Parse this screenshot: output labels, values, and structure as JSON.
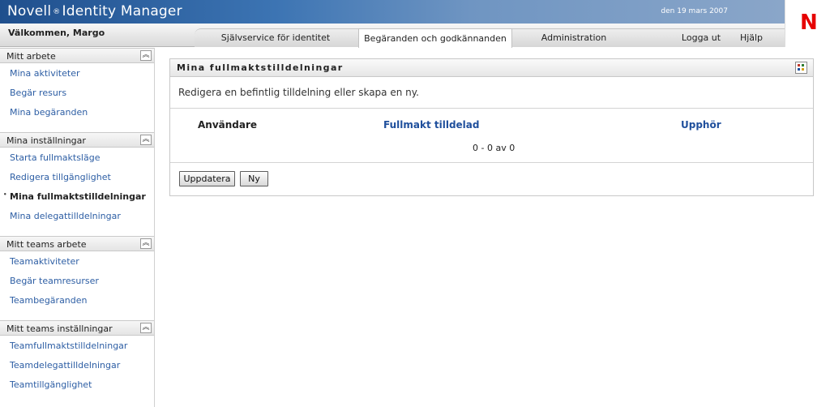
{
  "header": {
    "brand_name": "Novell",
    "brand_reg": "®",
    "brand_product": "Identity Manager",
    "date": "den 19 mars 2007",
    "welcome": "Välkommen, Margo",
    "logo_letter": "N",
    "colors": {
      "brand_blue": "#2d62a4",
      "logo_red": "#e60000",
      "link_blue": "#2d5ea4"
    }
  },
  "tabs": [
    {
      "label": "Självservice för identitet"
    },
    {
      "label": "Begäranden och godkännanden",
      "active": true
    },
    {
      "label": "Administration"
    },
    {
      "label": "Logga ut"
    },
    {
      "label": "Hjälp"
    }
  ],
  "sidebar": {
    "sections": [
      {
        "title": "Mitt arbete",
        "items": [
          "Mina aktiviteter",
          "Begär resurs",
          "Mina begäranden"
        ]
      },
      {
        "title": "Mina inställningar",
        "items": [
          "Starta fullmaktsläge",
          "Redigera tillgänglighet",
          "Mina fullmaktstilldelningar",
          "Mina delegattilldelningar"
        ],
        "current": "Mina fullmaktstilldelningar"
      },
      {
        "title": "Mitt teams arbete",
        "items": [
          "Teamaktiviteter",
          "Begär teamresurser",
          "Teambegäranden"
        ]
      },
      {
        "title": "Mitt teams inställningar",
        "items": [
          "Teamfullmaktstilldelningar",
          "Teamdelegattilldelningar",
          "Teamtillgänglighet"
        ]
      }
    ],
    "collapse_icon": "chevron-up-icon"
  },
  "panel": {
    "title": "Mina fullmaktstilldelningar",
    "description": "Redigera en befintlig tilldelning eller skapa en ny.",
    "columns": {
      "user": "Användare",
      "assigned": "Fullmakt tilldelad",
      "expires": "Upphör"
    },
    "count": "0 - 0 av 0",
    "buttons": {
      "refresh": "Uppdatera",
      "new": "Ny"
    },
    "icon": "settings-grid-icon"
  }
}
